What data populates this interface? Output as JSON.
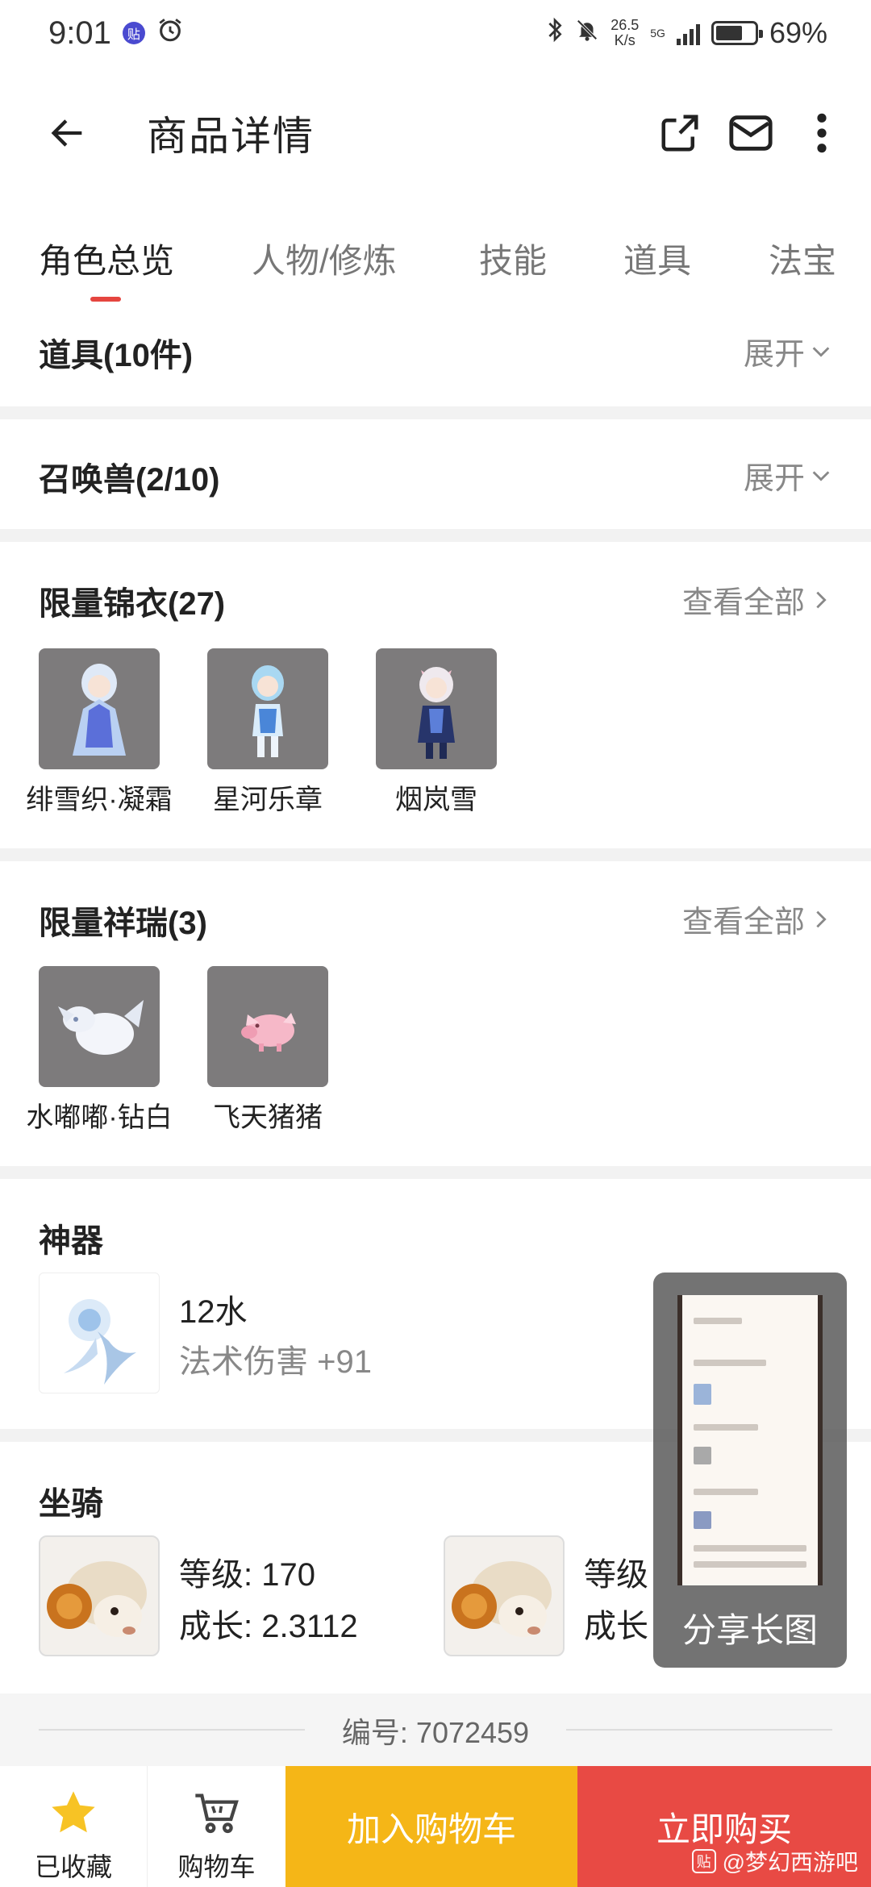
{
  "status_bar": {
    "time": "9:01",
    "app_badge": "贴",
    "net_speed_value": "26.5",
    "net_speed_unit": "K/s",
    "network": "5G",
    "battery_percent": "69%",
    "battery_level": 0.69
  },
  "header": {
    "title": "商品详情"
  },
  "tabs": [
    {
      "label": "角色总览",
      "active": true
    },
    {
      "label": "人物/修炼",
      "active": false
    },
    {
      "label": "技能",
      "active": false
    },
    {
      "label": "道具",
      "active": false
    },
    {
      "label": "法宝",
      "active": false
    }
  ],
  "sections": {
    "items": {
      "title": "道具(10件)",
      "action": "展开"
    },
    "pets": {
      "title": "召唤兽(2/10)",
      "action": "展开"
    },
    "outfits": {
      "title": "限量锦衣(27)",
      "action": "查看全部",
      "entries": [
        "绯雪织·凝霜",
        "星河乐章",
        "烟岚雪"
      ]
    },
    "auspicious": {
      "title": "限量祥瑞(3)",
      "action": "查看全部",
      "entries": [
        "水嘟嘟·钻白",
        "飞天猪猪"
      ]
    },
    "artifact": {
      "title": "神器",
      "name": "12水",
      "stat": "法术伤害 +91"
    },
    "mounts": {
      "title": "坐骑",
      "entries": [
        {
          "level": "等级: 170",
          "growth": "成长: 2.3112"
        },
        {
          "level": "等级",
          "growth": "成长"
        }
      ]
    }
  },
  "floating_card": {
    "label": "分享长图"
  },
  "footer": {
    "serial": "编号:  7072459"
  },
  "bottom_bar": {
    "favorite_label": "已收藏",
    "cart_label": "购物车",
    "add_to_cart": "加入购物车",
    "buy_now": "立即购买",
    "watermark": "@梦幻西游吧",
    "watermark_badge": "贴"
  },
  "colors": {
    "accent_red": "#e5453f",
    "add_cart_yellow": "#f5b617",
    "buy_red": "#e84a44",
    "star_yellow": "#f7c325"
  }
}
